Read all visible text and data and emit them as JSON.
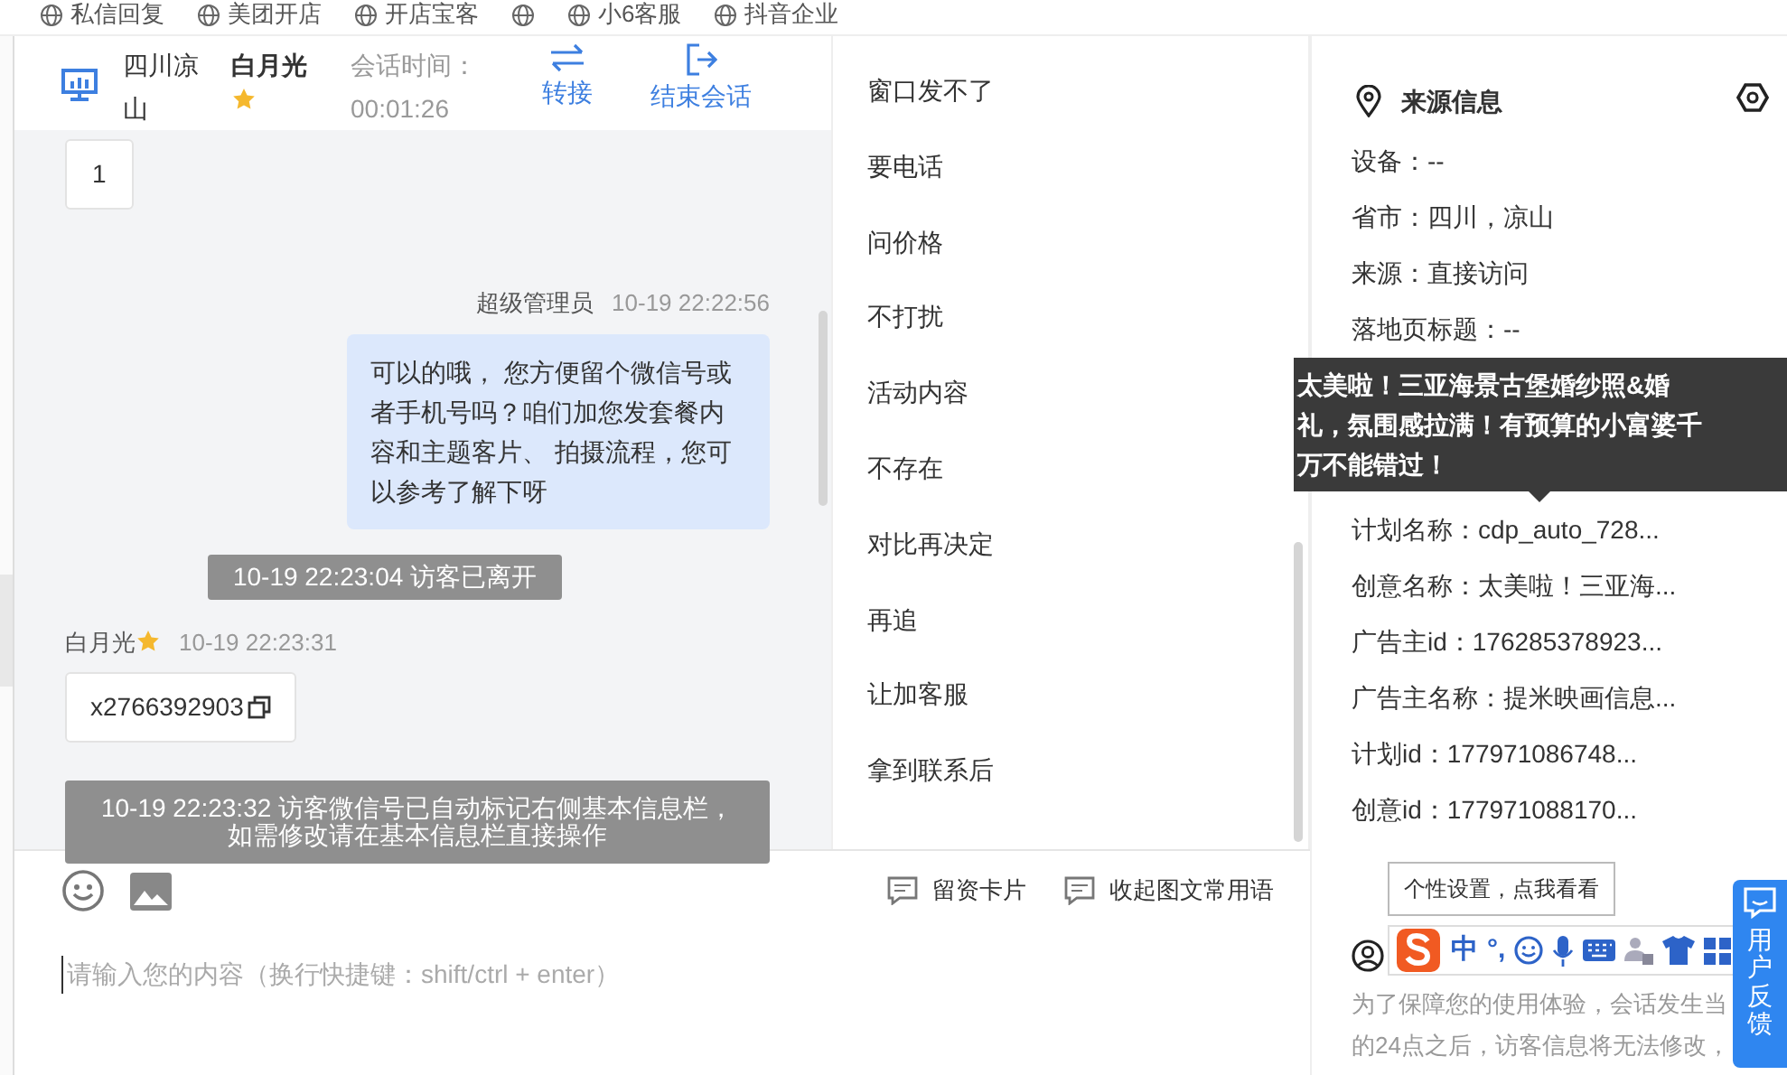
{
  "bookmarks": [
    {
      "kind": "link",
      "label": "私信回复"
    },
    {
      "kind": "link",
      "label": "美团开店"
    },
    {
      "kind": "link",
      "label": "开店宝客"
    },
    {
      "kind": "icon"
    },
    {
      "kind": "link",
      "label": "小6客服"
    },
    {
      "kind": "link",
      "label": "抖音企业"
    }
  ],
  "chat_header": {
    "location": "四川凉山",
    "visitor": "白月光",
    "starred": true,
    "session_label": "会话时间：",
    "session_time": "00:01:26",
    "actions": [
      {
        "kind": "transfer",
        "label": "转接"
      },
      {
        "kind": "end",
        "label": "结束会话"
      }
    ]
  },
  "messages": [
    {
      "kind": "visitor_text",
      "text": "1"
    },
    {
      "kind": "agent_meta",
      "sender": "超级管理员",
      "time": "10-19 22:22:56"
    },
    {
      "kind": "agent_text",
      "text": "可以的哦， 您方便留个微信号或者手机号吗？咱们加您发套餐内容和主题客片、 拍摄流程，您可以参考了解下呀"
    },
    {
      "kind": "system",
      "lines": [
        "10-19 22:23:04 访客已离开"
      ]
    },
    {
      "kind": "visitor_meta",
      "sender": "白月光",
      "starred": true,
      "time": "10-19 22:23:31"
    },
    {
      "kind": "copy",
      "text": "x2766392903"
    },
    {
      "kind": "system",
      "lines": [
        "10-19 22:23:32 访客微信号已自动标记右侧基本信息栏，",
        "如需修改请在基本信息栏直接操作"
      ]
    }
  ],
  "phrases": [
    "窗口发不了",
    "要电话",
    "问价格",
    "不打扰",
    "活动内容",
    "不存在",
    "对比再决定",
    "再追",
    "让加客服",
    "拿到联系后"
  ],
  "toolbar": {
    "buttons": [
      {
        "label": "留资卡片"
      },
      {
        "label": "收起图文常用语"
      }
    ]
  },
  "input": {
    "placeholder": "请输入您的内容（换行快捷键：shift/ctrl + enter）"
  },
  "source_info": {
    "title": "来源信息",
    "rows": [
      {
        "kind": "row",
        "text": "设备：--"
      },
      {
        "kind": "row",
        "text": "省市：四川，凉山"
      },
      {
        "kind": "row",
        "text": "来源：直接访问"
      },
      {
        "kind": "row",
        "text": "落地页标题：--"
      },
      {
        "kind": "tooltip",
        "lines": [
          "太美啦！三亚海景古堡婚纱照&婚",
          "礼，氛围感拉满！有预算的小富婆千",
          "万不能错过！"
        ]
      },
      {
        "kind": "row",
        "text": "计划名称：cdp_auto_728..."
      },
      {
        "kind": "row",
        "text": "创意名称：太美啦！三亚海..."
      },
      {
        "kind": "row",
        "text": "广告主id：176285378923..."
      },
      {
        "kind": "row",
        "text": "广告主名称：提米映画信息..."
      },
      {
        "kind": "row",
        "text": "计划id：177971086748..."
      },
      {
        "kind": "row",
        "text": "创意id：177971088170..."
      }
    ]
  },
  "ime": {
    "hint": "个性设置，点我看看",
    "mode": "中",
    "punct": "°,"
  },
  "notice_lines": [
    "为了保障您的使用体验，会话发生当",
    "的24点之后，访客信息将无法修改，"
  ],
  "feedback": {
    "label": "用户反馈"
  }
}
